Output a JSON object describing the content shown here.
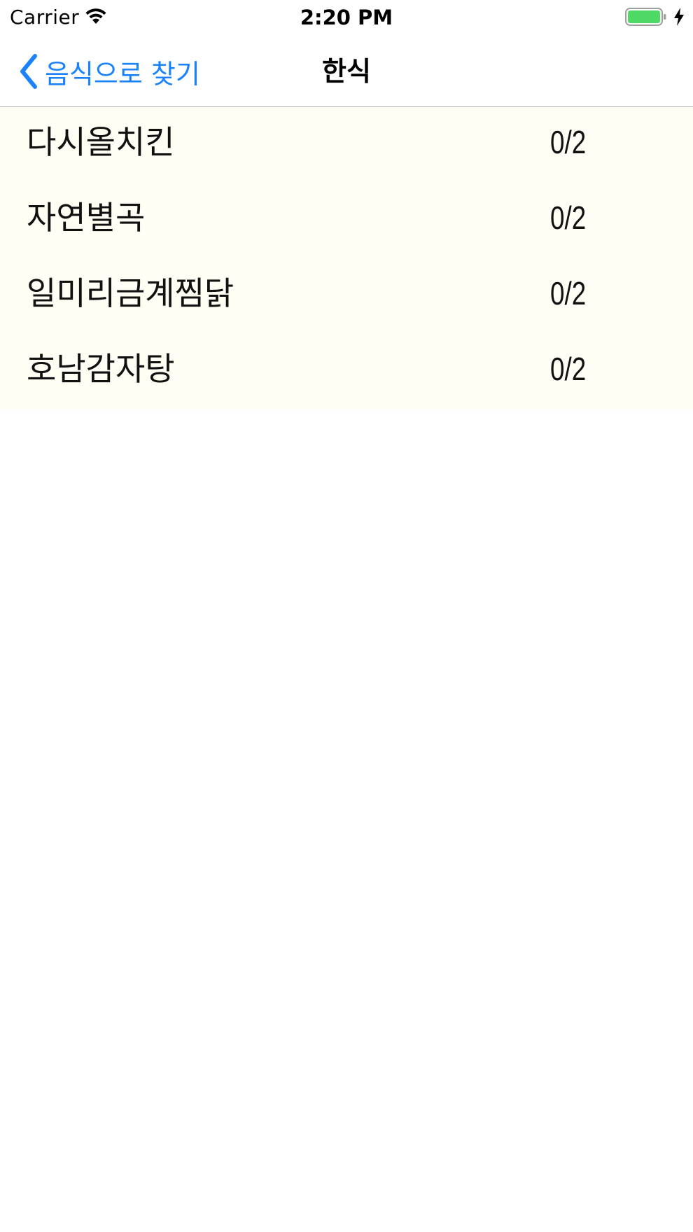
{
  "status_bar": {
    "carrier": "Carrier",
    "time": "2:20 PM",
    "battery_color": "#4cd964"
  },
  "nav": {
    "back_label": "음식으로 찾기",
    "title": "한식",
    "accent_color": "#1a82fb"
  },
  "list": {
    "background": "#fffdf4",
    "items": [
      {
        "name": "다시올치킨",
        "count": "0/2"
      },
      {
        "name": "자연별곡",
        "count": "0/2"
      },
      {
        "name": "일미리금계찜닭",
        "count": "0/2"
      },
      {
        "name": "호남감자탕",
        "count": "0/2"
      }
    ]
  }
}
